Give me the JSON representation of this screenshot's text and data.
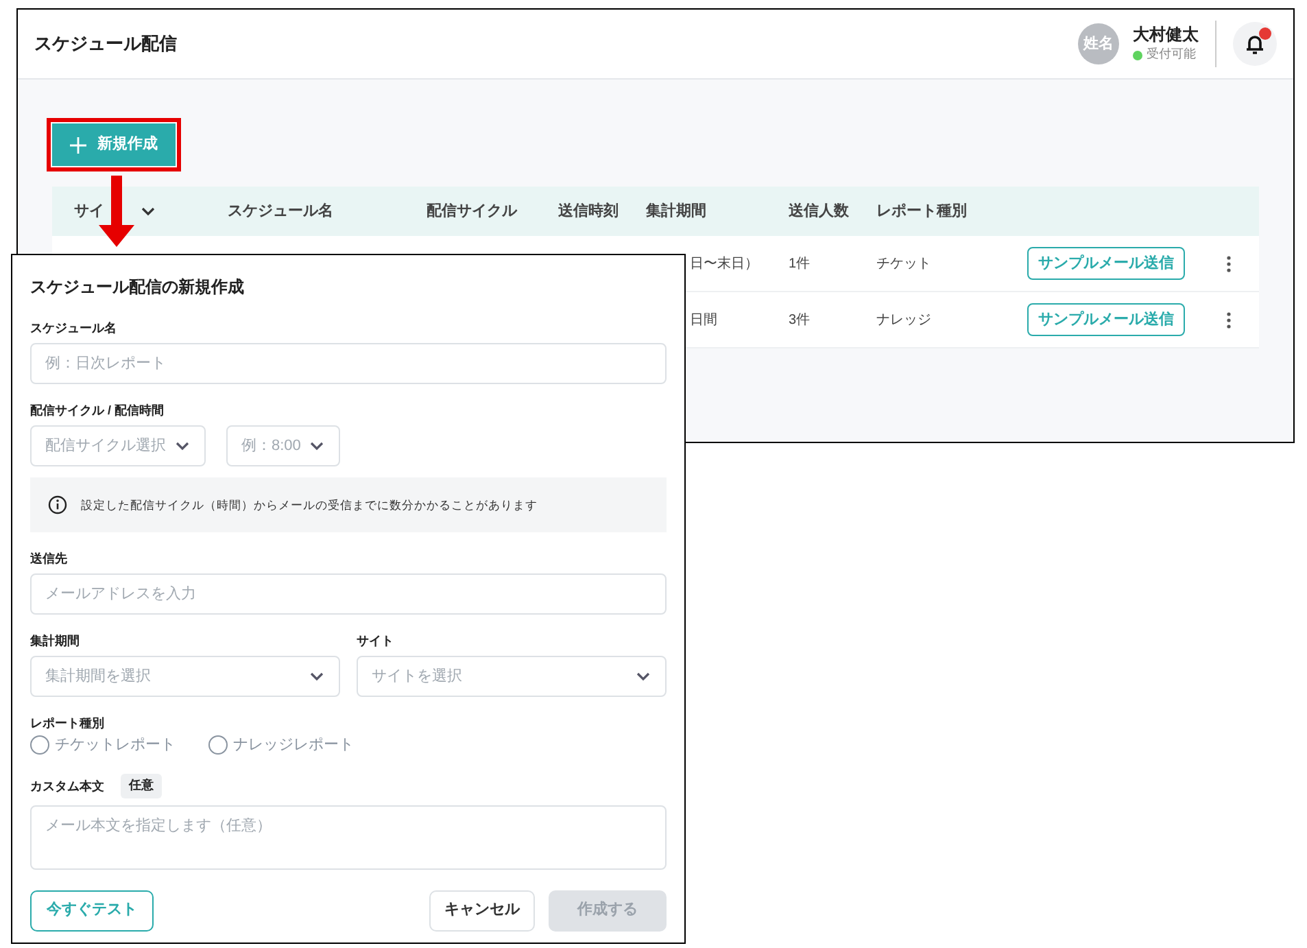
{
  "page": {
    "title": "スケジュール配信"
  },
  "user": {
    "avatar": "姓名",
    "name": "大村健太",
    "status": "受付可能",
    "has_notification": true
  },
  "create_button": {
    "label": "新規作成",
    "highlighted": true
  },
  "table": {
    "columns": [
      "サイ",
      "スケジュール名",
      "配信サイクル",
      "送信時刻",
      "集計期間",
      "送信人数",
      "レポート種別"
    ],
    "rows": [
      {
        "period": "日〜末日）",
        "recipients": "1件",
        "report_type": "チケット",
        "action": "サンプルメール送信"
      },
      {
        "period": "日間",
        "recipients": "3件",
        "report_type": "ナレッジ",
        "action": "サンプルメール送信"
      }
    ]
  },
  "dialog": {
    "title": "スケジュール配信の新規作成",
    "schedule_name": {
      "label": "スケジュール名",
      "placeholder": "例：日次レポート"
    },
    "cycle": {
      "label": "配信サイクル / 配信時間",
      "cycle_placeholder": "配信サイクル選択",
      "time_placeholder": "例：8:00"
    },
    "notice": "設定した配信サイクル（時間）からメールの受信までに数分かかることがあります",
    "recipient": {
      "label": "送信先",
      "placeholder": "メールアドレスを入力"
    },
    "period": {
      "label": "集計期間",
      "placeholder": "集計期間を選択"
    },
    "site": {
      "label": "サイト",
      "placeholder": "サイトを選択"
    },
    "report_type": {
      "label": "レポート種別",
      "options": [
        {
          "label": "チケットレポート",
          "selected": false
        },
        {
          "label": "ナレッジレポート",
          "selected": false
        }
      ]
    },
    "custom_body": {
      "label": "カスタム本文",
      "badge": "任意",
      "placeholder": "メール本文を指定します（任意）"
    },
    "test_button": "今すぐテスト",
    "cancel_button": "キャンセル",
    "create_button": {
      "label": "作成する",
      "disabled": true
    }
  }
}
